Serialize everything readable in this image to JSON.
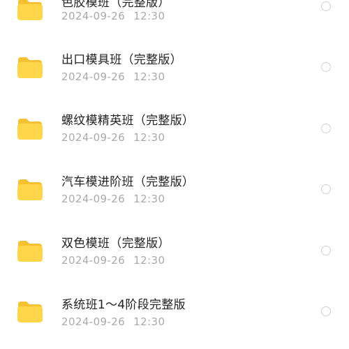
{
  "files": [
    {
      "name": "色胶模班（完整版）",
      "date": "2024-09-26",
      "time": "12:30",
      "icon": "folder-icon"
    },
    {
      "name": "出口模具班（完整版）",
      "date": "2024-09-26",
      "time": "12:30",
      "icon": "folder-icon"
    },
    {
      "name": "螺纹模精英班（完整版）",
      "date": "2024-09-26",
      "time": "12:30",
      "icon": "folder-icon"
    },
    {
      "name": "汽车模进阶班（完整版）",
      "date": "2024-09-26",
      "time": "12:30",
      "icon": "folder-icon"
    },
    {
      "name": "双色模班（完整版）",
      "date": "2024-09-26",
      "time": "12:30",
      "icon": "folder-icon"
    },
    {
      "name": "系统班1～4阶段完整版",
      "date": "2024-09-26",
      "time": "12:30",
      "icon": "folder-icon"
    }
  ],
  "colors": {
    "folder_back": "#f5c031",
    "folder_front": "#ffd54a",
    "radio_border": "#cfcfcf"
  }
}
